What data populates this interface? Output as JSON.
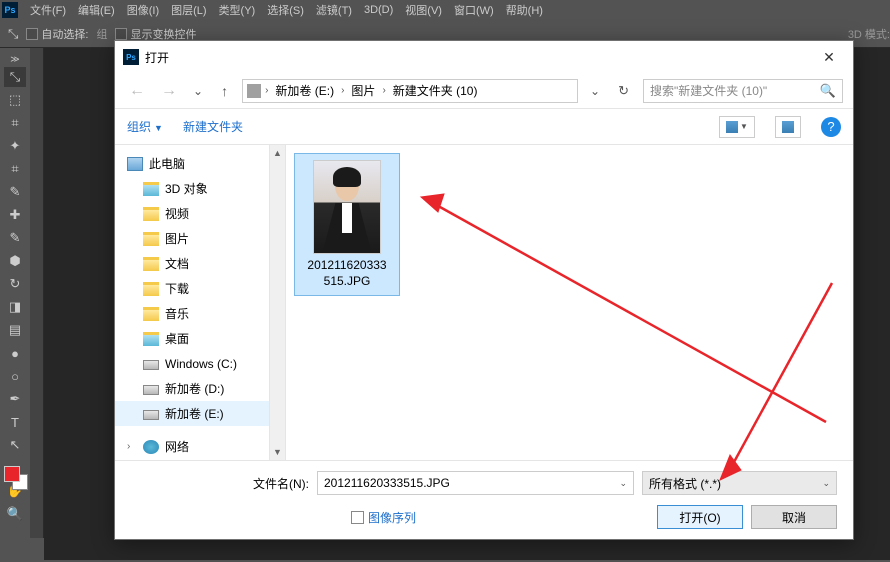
{
  "menubar": {
    "items": [
      "文件(F)",
      "编辑(E)",
      "图像(I)",
      "图层(L)",
      "类型(Y)",
      "选择(S)",
      "滤镜(T)",
      "3D(D)",
      "视图(V)",
      "窗口(W)",
      "帮助(H)"
    ]
  },
  "optionsbar": {
    "auto_select": "自动选择:",
    "group": "组",
    "show_transform": "显示变换控件",
    "mode_3d": "3D 模式:"
  },
  "dialog": {
    "title": "打开",
    "breadcrumb": [
      "新加卷 (E:)",
      "图片",
      "新建文件夹 (10)"
    ],
    "search_placeholder": "搜索\"新建文件夹 (10)\"",
    "toolbar": {
      "organize": "组织",
      "new_folder": "新建文件夹"
    },
    "tree": {
      "this_pc": "此电脑",
      "items": [
        "3D 对象",
        "视频",
        "图片",
        "文档",
        "下载",
        "音乐",
        "桌面",
        "Windows (C:)",
        "新加卷 (D:)",
        "新加卷 (E:)"
      ],
      "network": "网络"
    },
    "file": {
      "name_line1": "201211620333",
      "name_line2": "515.JPG"
    },
    "footer": {
      "filename_label": "文件名(N):",
      "filename_value": "201211620333515.JPG",
      "format": "所有格式 (*.*)",
      "sequence": "图像序列",
      "open": "打开(O)",
      "cancel": "取消"
    }
  }
}
